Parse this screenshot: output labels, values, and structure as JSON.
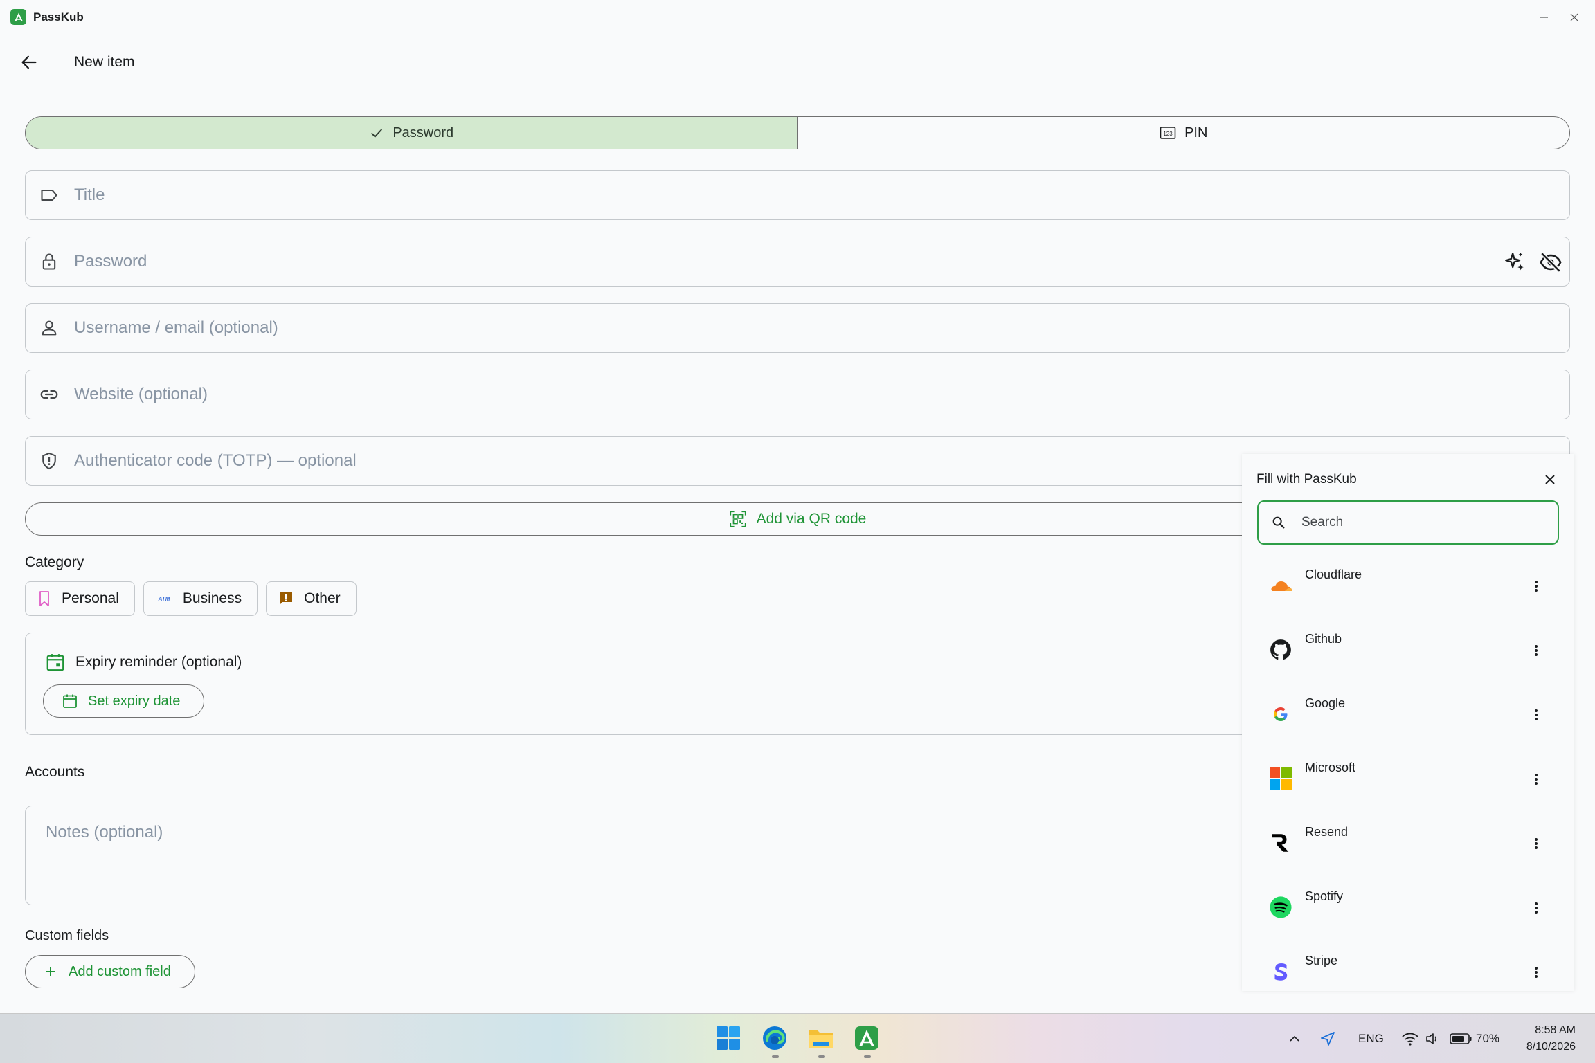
{
  "window": {
    "app_name": "PassKub",
    "minimize_label": "–",
    "close_label": "✕"
  },
  "header": {
    "title": "New item"
  },
  "type_toggle": {
    "password_label": "Password",
    "pin_label": "PIN"
  },
  "fields": {
    "title_placeholder": "Title",
    "password_placeholder": "Password",
    "username_placeholder": "Username / email (optional)",
    "website_placeholder": "Website (optional)",
    "totp_placeholder": "Authenticator code (TOTP) — optional"
  },
  "qr_button": "Add via QR code",
  "category": {
    "label": "Category",
    "chips": [
      "Personal",
      "Business",
      "Other"
    ]
  },
  "expiry": {
    "title": "Expiry reminder (optional)",
    "button": "Set expiry date"
  },
  "accounts_label": "Accounts",
  "notes_placeholder": "Notes (optional)",
  "custom_fields": {
    "label": "Custom fields",
    "button": "Add custom field"
  },
  "autofill": {
    "title": "Fill with PassKub",
    "search_placeholder": "Search",
    "items": [
      {
        "name": "Cloudflare",
        "icon": "cloudflare-icon"
      },
      {
        "name": "Github",
        "icon": "github-icon"
      },
      {
        "name": "Google",
        "icon": "google-icon"
      },
      {
        "name": "Microsoft",
        "icon": "microsoft-icon"
      },
      {
        "name": "Resend",
        "icon": "resend-icon"
      },
      {
        "name": "Spotify",
        "icon": "spotify-icon"
      },
      {
        "name": "Stripe",
        "icon": "stripe-icon"
      }
    ]
  },
  "taskbar": {
    "language": "ENG",
    "battery": "70%",
    "time": "8:58 AM",
    "date": "8/10/2026"
  },
  "colors": {
    "accent": "#2e9e47",
    "accent_text": "#1f9436",
    "segment_active": "#d3e9cf",
    "outline": "#c4c8cc",
    "placeholder": "#8894a3"
  }
}
